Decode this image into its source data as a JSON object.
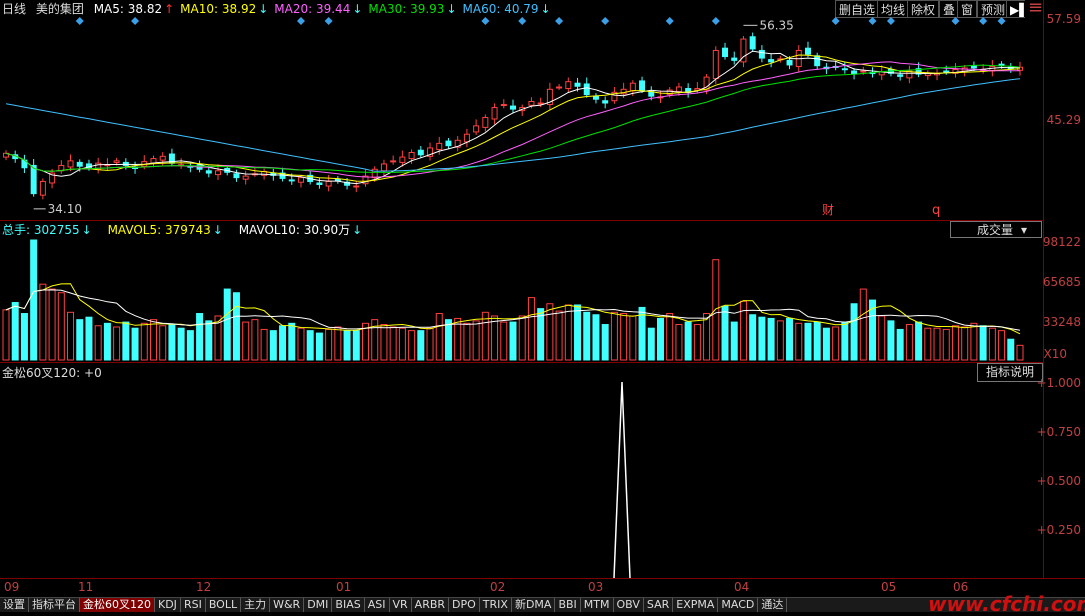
{
  "header": {
    "period": "日线",
    "stock": "美的集团",
    "ma": [
      {
        "label": "MA5: 38.82",
        "arrow": "↑",
        "color": "#ffffff",
        "arrow_color": "#ff3030"
      },
      {
        "label": "MA10: 38.92",
        "arrow": "↓",
        "color": "#ffff00",
        "arrow_color": "#40ffff"
      },
      {
        "label": "MA20: 39.44",
        "arrow": "↓",
        "color": "#ff60ff",
        "arrow_color": "#40ffff"
      },
      {
        "label": "MA30: 39.93",
        "arrow": "↓",
        "color": "#00e000",
        "arrow_color": "#40ffff"
      },
      {
        "label": "MA60: 40.79",
        "arrow": "↓",
        "color": "#40c0ff",
        "arrow_color": "#40ffff"
      }
    ]
  },
  "toolbar": {
    "b1": "删自选",
    "b2": "均线",
    "b3": "除权",
    "b4": "叠",
    "b5": "窗",
    "b6": "预测"
  },
  "price_panel": {
    "y_labels": [
      "57.59",
      "45.29"
    ],
    "high_label": "56.35",
    "low_label": "34.10",
    "markers": {
      "cai": "财",
      "q": "q"
    }
  },
  "volume_panel": {
    "total": "总手: 302755",
    "mavol5": "MAVOL5: 379743",
    "mavol10": "MAVOL10: 30.90万",
    "dropdown": "成交量",
    "y_labels": [
      "98122",
      "65685",
      "33248"
    ],
    "unit": "X10"
  },
  "indicator_panel": {
    "title": "金松60叉120: +0",
    "button": "指标说明",
    "y_labels": [
      "1.000",
      "0.750",
      "0.500",
      "0.250"
    ]
  },
  "x_axis": [
    "09",
    "11",
    "12",
    "01",
    "02",
    "03",
    "04",
    "05",
    "06"
  ],
  "tabs": [
    "设置",
    "指标平台",
    "金松60叉120",
    "KDJ",
    "RSI",
    "BOLL",
    "主力",
    "W&R",
    "DMI",
    "BIAS",
    "ASI",
    "VR",
    "ARBR",
    "DPO",
    "TRIX",
    "新DMA",
    "BBI",
    "MTM",
    "OBV",
    "SAR",
    "EXPMA",
    "MACD",
    "通达"
  ],
  "watermark": "www.cfchi.com",
  "chart_data": {
    "type": "candlestick",
    "ylim": [
      32,
      58
    ],
    "close": [
      40.5,
      39.8,
      38.6,
      35.2,
      36.8,
      37.9,
      38.9,
      39.5,
      38.8,
      38.6,
      39.2,
      39.0,
      39.5,
      38.9,
      38.5,
      39.4,
      39.8,
      40.1,
      39.2,
      39.0,
      38.7,
      38.4,
      37.9,
      38.2,
      38.0,
      37.3,
      37.5,
      37.8,
      38.1,
      37.6,
      37.2,
      36.9,
      37.3,
      36.8,
      36.4,
      36.8,
      36.9,
      36.3,
      36.2,
      37.5,
      38.4,
      39.1,
      39.5,
      40.0,
      40.6,
      40.3,
      41.2,
      41.8,
      41.5,
      42.2,
      43.0,
      44.1,
      45.2,
      46.5,
      46.9,
      46.3,
      46.5,
      47.3,
      47.1,
      48.9,
      49.2,
      49.9,
      49.3,
      48.2,
      47.6,
      47.1,
      48.5,
      48.9,
      49.7,
      48.8,
      48.0,
      47.9,
      48.8,
      49.2,
      48.5,
      49.0,
      50.5,
      54.0,
      53.2,
      52.7,
      55.5,
      54.2,
      53.0,
      52.5,
      52.9,
      52.1,
      54.0,
      53.5,
      52.0,
      51.6,
      51.8,
      51.5,
      50.9,
      51.3,
      51.0,
      51.2,
      51.0,
      50.6,
      51.3,
      50.9,
      51.0,
      51.0,
      51.2,
      51.5,
      51.7,
      51.7,
      51.5,
      51.9,
      52.0,
      51.6,
      51.8
    ],
    "volume": [
      41000,
      47000,
      38000,
      98122,
      62000,
      58000,
      55000,
      39000,
      33000,
      35000,
      28000,
      30000,
      27000,
      31000,
      26000,
      30000,
      33000,
      28000,
      29000,
      26000,
      24000,
      38000,
      32000,
      36000,
      58000,
      55000,
      31000,
      33000,
      25000,
      24000,
      28000,
      30000,
      26000,
      24000,
      22000,
      25000,
      27000,
      24000,
      24000,
      30000,
      33000,
      29000,
      27000,
      26000,
      24000,
      24000,
      26000,
      38000,
      33000,
      34000,
      30000,
      32000,
      39000,
      36000,
      31000,
      31000,
      36000,
      51000,
      42000,
      46000,
      40000,
      45000,
      45000,
      39000,
      37000,
      29000,
      39000,
      38000,
      36000,
      43000,
      26000,
      34000,
      38000,
      29000,
      31000,
      29000,
      38000,
      82000,
      44000,
      31000,
      48000,
      37000,
      35000,
      34000,
      32000,
      34000,
      30000,
      30000,
      31000,
      26000,
      27000,
      31000,
      46000,
      58000,
      49000,
      36000,
      32000,
      25000,
      29000,
      31000,
      26000,
      26000,
      25000,
      28000,
      27000,
      30000,
      28000,
      26000,
      24000,
      17000,
      12000
    ]
  }
}
